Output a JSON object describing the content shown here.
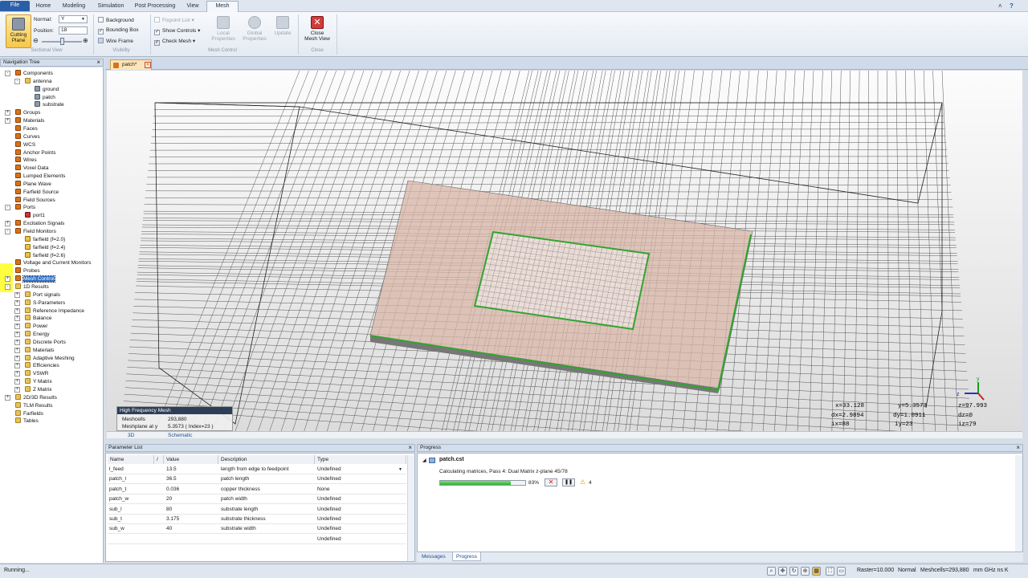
{
  "ribbon": {
    "tabs": [
      "File",
      "Home",
      "Modeling",
      "Simulation",
      "Post Processing",
      "View",
      "Mesh"
    ],
    "active_tab": "Mesh",
    "cutting_plane_label": [
      "Cutting",
      "Plane"
    ],
    "normal_label": "Normal:",
    "normal_value": "Y",
    "position_label": "Position:",
    "position_value": "18",
    "sectional_view_group": "Sectional View",
    "background_label": "Background",
    "bounding_box_label": "Bounding Box",
    "wire_frame_label": "Wire Frame",
    "visibility_group": "Visibility",
    "fixpoint_list_label": "Fixpoint List",
    "show_controls_label": "Show Controls",
    "check_mesh_label": "Check Mesh",
    "local_properties_label": [
      "Local",
      "Properties"
    ],
    "global_properties_label": [
      "Global",
      "Properties"
    ],
    "update_label": "Update",
    "mesh_control_group": "Mesh Control",
    "close_mesh_view_label": [
      "Close",
      "Mesh View"
    ],
    "close_group": "Close"
  },
  "nav": {
    "title": "Navigation Tree",
    "items": [
      {
        "label": "Components",
        "depth": 0,
        "exp": "-",
        "icon": "orange"
      },
      {
        "label": "antenna",
        "depth": 1,
        "exp": "-",
        "icon": "folder"
      },
      {
        "label": "ground",
        "depth": 2,
        "exp": "",
        "icon": "solid"
      },
      {
        "label": "patch",
        "depth": 2,
        "exp": "",
        "icon": "solid"
      },
      {
        "label": "substrate",
        "depth": 2,
        "exp": "",
        "icon": "solid"
      },
      {
        "label": "Groups",
        "depth": 0,
        "exp": "+",
        "icon": "orange"
      },
      {
        "label": "Materials",
        "depth": 0,
        "exp": "+",
        "icon": "orange"
      },
      {
        "label": "Faces",
        "depth": 0,
        "exp": "",
        "icon": "orange"
      },
      {
        "label": "Curves",
        "depth": 0,
        "exp": "",
        "icon": "orange"
      },
      {
        "label": "WCS",
        "depth": 0,
        "exp": "",
        "icon": "orange"
      },
      {
        "label": "Anchor Points",
        "depth": 0,
        "exp": "",
        "icon": "orange"
      },
      {
        "label": "Wires",
        "depth": 0,
        "exp": "",
        "icon": "orange"
      },
      {
        "label": "Voxel Data",
        "depth": 0,
        "exp": "",
        "icon": "orange"
      },
      {
        "label": "Lumped Elements",
        "depth": 0,
        "exp": "",
        "icon": "orange"
      },
      {
        "label": "Plane Wave",
        "depth": 0,
        "exp": "",
        "icon": "orange"
      },
      {
        "label": "Farfield Source",
        "depth": 0,
        "exp": "",
        "icon": "orange"
      },
      {
        "label": "Field Sources",
        "depth": 0,
        "exp": "",
        "icon": "orange"
      },
      {
        "label": "Ports",
        "depth": 0,
        "exp": "-",
        "icon": "orange"
      },
      {
        "label": "port1",
        "depth": 1,
        "exp": "",
        "icon": "port"
      },
      {
        "label": "Excitation Signals",
        "depth": 0,
        "exp": "+",
        "icon": "orange"
      },
      {
        "label": "Field Monitors",
        "depth": 0,
        "exp": "-",
        "icon": "orange"
      },
      {
        "label": "farfield (f=2.0)",
        "depth": 1,
        "exp": "",
        "icon": "mon"
      },
      {
        "label": "farfield (f=2.4)",
        "depth": 1,
        "exp": "",
        "icon": "mon"
      },
      {
        "label": "farfield (f=2.6)",
        "depth": 1,
        "exp": "",
        "icon": "mon"
      },
      {
        "label": "Voltage and Current Monitors",
        "depth": 0,
        "exp": "",
        "icon": "orange"
      },
      {
        "label": "Probes",
        "depth": 0,
        "exp": "",
        "icon": "orange"
      },
      {
        "label": "Mesh Control",
        "depth": 0,
        "exp": "+",
        "icon": "orange",
        "selected": true
      },
      {
        "label": "1D Results",
        "depth": 0,
        "exp": "-",
        "icon": "folder"
      },
      {
        "label": "Port signals",
        "depth": 1,
        "exp": "+",
        "icon": "folder"
      },
      {
        "label": "S-Parameters",
        "depth": 1,
        "exp": "+",
        "icon": "folder"
      },
      {
        "label": "Reference Impedance",
        "depth": 1,
        "exp": "+",
        "icon": "folder"
      },
      {
        "label": "Balance",
        "depth": 1,
        "exp": "+",
        "icon": "folder"
      },
      {
        "label": "Power",
        "depth": 1,
        "exp": "+",
        "icon": "folder"
      },
      {
        "label": "Energy",
        "depth": 1,
        "exp": "+",
        "icon": "folder"
      },
      {
        "label": "Discrete Ports",
        "depth": 1,
        "exp": "+",
        "icon": "folder"
      },
      {
        "label": "Materials",
        "depth": 1,
        "exp": "+",
        "icon": "folder"
      },
      {
        "label": "Adaptive Meshing",
        "depth": 1,
        "exp": "+",
        "icon": "folder"
      },
      {
        "label": "Efficiencies",
        "depth": 1,
        "exp": "+",
        "icon": "folder"
      },
      {
        "label": "VSWR",
        "depth": 1,
        "exp": "+",
        "icon": "folder"
      },
      {
        "label": "Y Matrix",
        "depth": 1,
        "exp": "+",
        "icon": "folder"
      },
      {
        "label": "Z Matrix",
        "depth": 1,
        "exp": "+",
        "icon": "folder"
      },
      {
        "label": "2D/3D Results",
        "depth": 0,
        "exp": "+",
        "icon": "folder"
      },
      {
        "label": "TLM Results",
        "depth": 0,
        "exp": "",
        "icon": "folder"
      },
      {
        "label": "Farfields",
        "depth": 0,
        "exp": "",
        "icon": "folder"
      },
      {
        "label": "Tables",
        "depth": 0,
        "exp": "",
        "icon": "folder"
      }
    ]
  },
  "document": {
    "tab_label": "patch*",
    "view_tabs": [
      "3D",
      "Schematic"
    ],
    "hf_mesh": {
      "title": "High Frequency Mesh",
      "meshcells_label": "Meshcells",
      "meshcells_value": "293,880",
      "meshplane_label": "Meshplane at y",
      "meshplane_value": "5.3573  ( Index=23 )"
    },
    "coords": {
      "x": "x=33.128",
      "y": "y=5.3573",
      "z": "z=97.993",
      "dx": "dx=2.9894",
      "dy": "dy=1.0911",
      "dz": "dz=0",
      "ix": "ix=88",
      "iy": "iy=23",
      "iz": "iz=79"
    }
  },
  "params": {
    "title": "Parameter List",
    "columns": [
      "Name",
      "/",
      "Value",
      "Description",
      "Type"
    ],
    "rows": [
      {
        "name": "l_feed",
        "value": "13.5",
        "desc": "length from edge to feedpoint",
        "type": "Undefined"
      },
      {
        "name": "patch_l",
        "value": "36.5",
        "desc": "patch length",
        "type": "Undefined"
      },
      {
        "name": "patch_t",
        "value": "0.036",
        "desc": "copper thickness",
        "type": "None"
      },
      {
        "name": "patch_w",
        "value": "20",
        "desc": "patch width",
        "type": "Undefined"
      },
      {
        "name": "sub_l",
        "value": "80",
        "desc": "substrate length",
        "type": "Undefined"
      },
      {
        "name": "sub_t",
        "value": "3.175",
        "desc": "substrate thickness",
        "type": "Undefined"
      },
      {
        "name": "sub_w",
        "value": "40",
        "desc": "substrate width",
        "type": "Undefined"
      },
      {
        "name": "",
        "value": "",
        "desc": "",
        "type": "Undefined"
      }
    ]
  },
  "progress": {
    "title": "Progress",
    "file": "patch.cst",
    "message": "Calculating matrices, Pass 4: Dual Matrix z-plane 45/78",
    "percent_text": "83%",
    "percent": 0.83,
    "warnings": "4",
    "tabs": [
      "Messages",
      "Progress"
    ]
  },
  "status": {
    "left": "Running...",
    "raster": "Raster=10.000",
    "mode": "Normal",
    "meshcells": "Meshcells=293,880",
    "units": "mm  GHz  ns  K"
  },
  "colors": {
    "substrate": "#d9b5a8",
    "patch_outline": "#2fa52f",
    "progress_fill": "#3cbf3c"
  }
}
